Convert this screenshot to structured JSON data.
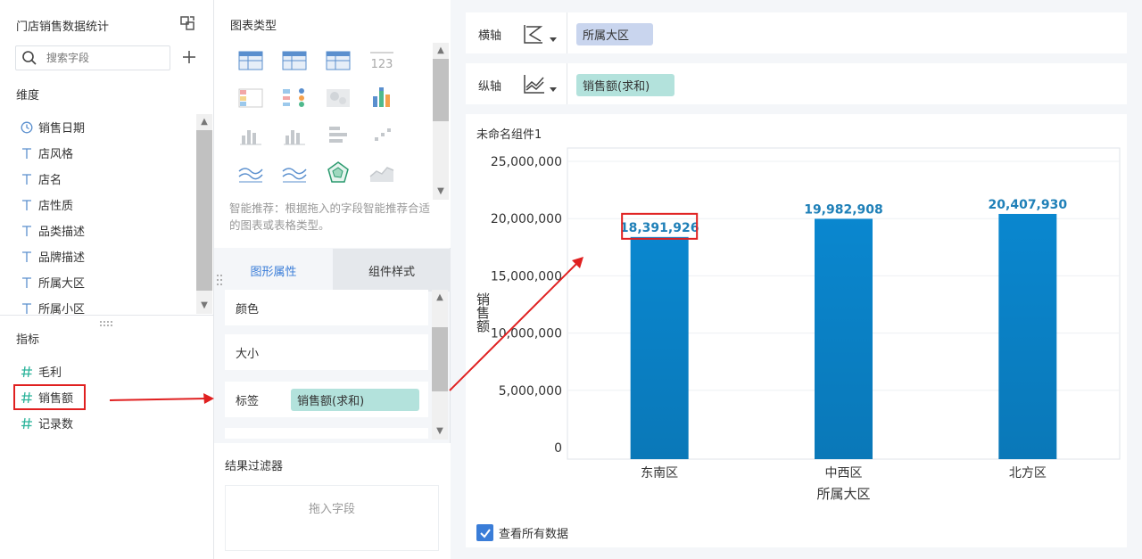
{
  "left": {
    "title": "门店销售数据统计",
    "search_placeholder": "搜索字段",
    "dimension_label": "维度",
    "dimensions": [
      {
        "label": "销售日期",
        "icon": "clock-icon"
      },
      {
        "label": "店风格",
        "icon": "text-field-icon"
      },
      {
        "label": "店名",
        "icon": "text-field-icon"
      },
      {
        "label": "店性质",
        "icon": "text-field-icon"
      },
      {
        "label": "品类描述",
        "icon": "text-field-icon"
      },
      {
        "label": "品牌描述",
        "icon": "text-field-icon"
      },
      {
        "label": "所属大区",
        "icon": "text-field-icon"
      },
      {
        "label": "所属小区",
        "icon": "text-field-icon"
      }
    ],
    "measure_label": "指标",
    "measures": [
      {
        "label": "毛利",
        "icon": "hash-icon"
      },
      {
        "label": "销售额",
        "icon": "hash-icon"
      },
      {
        "label": "记录数",
        "icon": "hash-icon"
      }
    ]
  },
  "mid": {
    "chart_type_label": "图表类型",
    "smart_hint": "智能推荐：根据拖入的字段智能推荐合适的图表或表格类型。",
    "tabs": {
      "graph_props": "图形属性",
      "component_style": "组件样式"
    },
    "props": {
      "color": "颜色",
      "size": "大小",
      "label": "标签",
      "label_value": "销售额(求和)"
    },
    "filter_label": "结果过滤器",
    "filter_drop": "拖入字段"
  },
  "right": {
    "x_axis_label": "横轴",
    "x_axis_field": "所属大区",
    "y_axis_label": "纵轴",
    "y_axis_field": "销售额(求和)",
    "component_title": "未命名组件1",
    "show_all_label": "查看所有数据",
    "show_all_checked": true
  },
  "colors": {
    "bar": "#0a87cf",
    "x_pill": "#c9d5ee",
    "y_pill": "#b3e2dc",
    "annotation": "#e02020",
    "accent": "#3a7dd8"
  },
  "chart_data": {
    "type": "bar",
    "categories": [
      "东南区",
      "中西区",
      "北方区"
    ],
    "values": [
      18391926,
      19982908,
      20407930
    ],
    "value_labels": [
      "18,391,926",
      "19,982,908",
      "20,407,930"
    ],
    "xlabel": "所属大区",
    "ylabel": "销售额",
    "ylim": [
      0,
      25000000
    ],
    "yticks": [
      0,
      5000000,
      10000000,
      15000000,
      20000000,
      25000000
    ],
    "ytick_labels": [
      "0",
      "5,000,000",
      "10,000,000",
      "15,000,000",
      "20,000,000",
      "25,000,000"
    ],
    "grid": true
  }
}
